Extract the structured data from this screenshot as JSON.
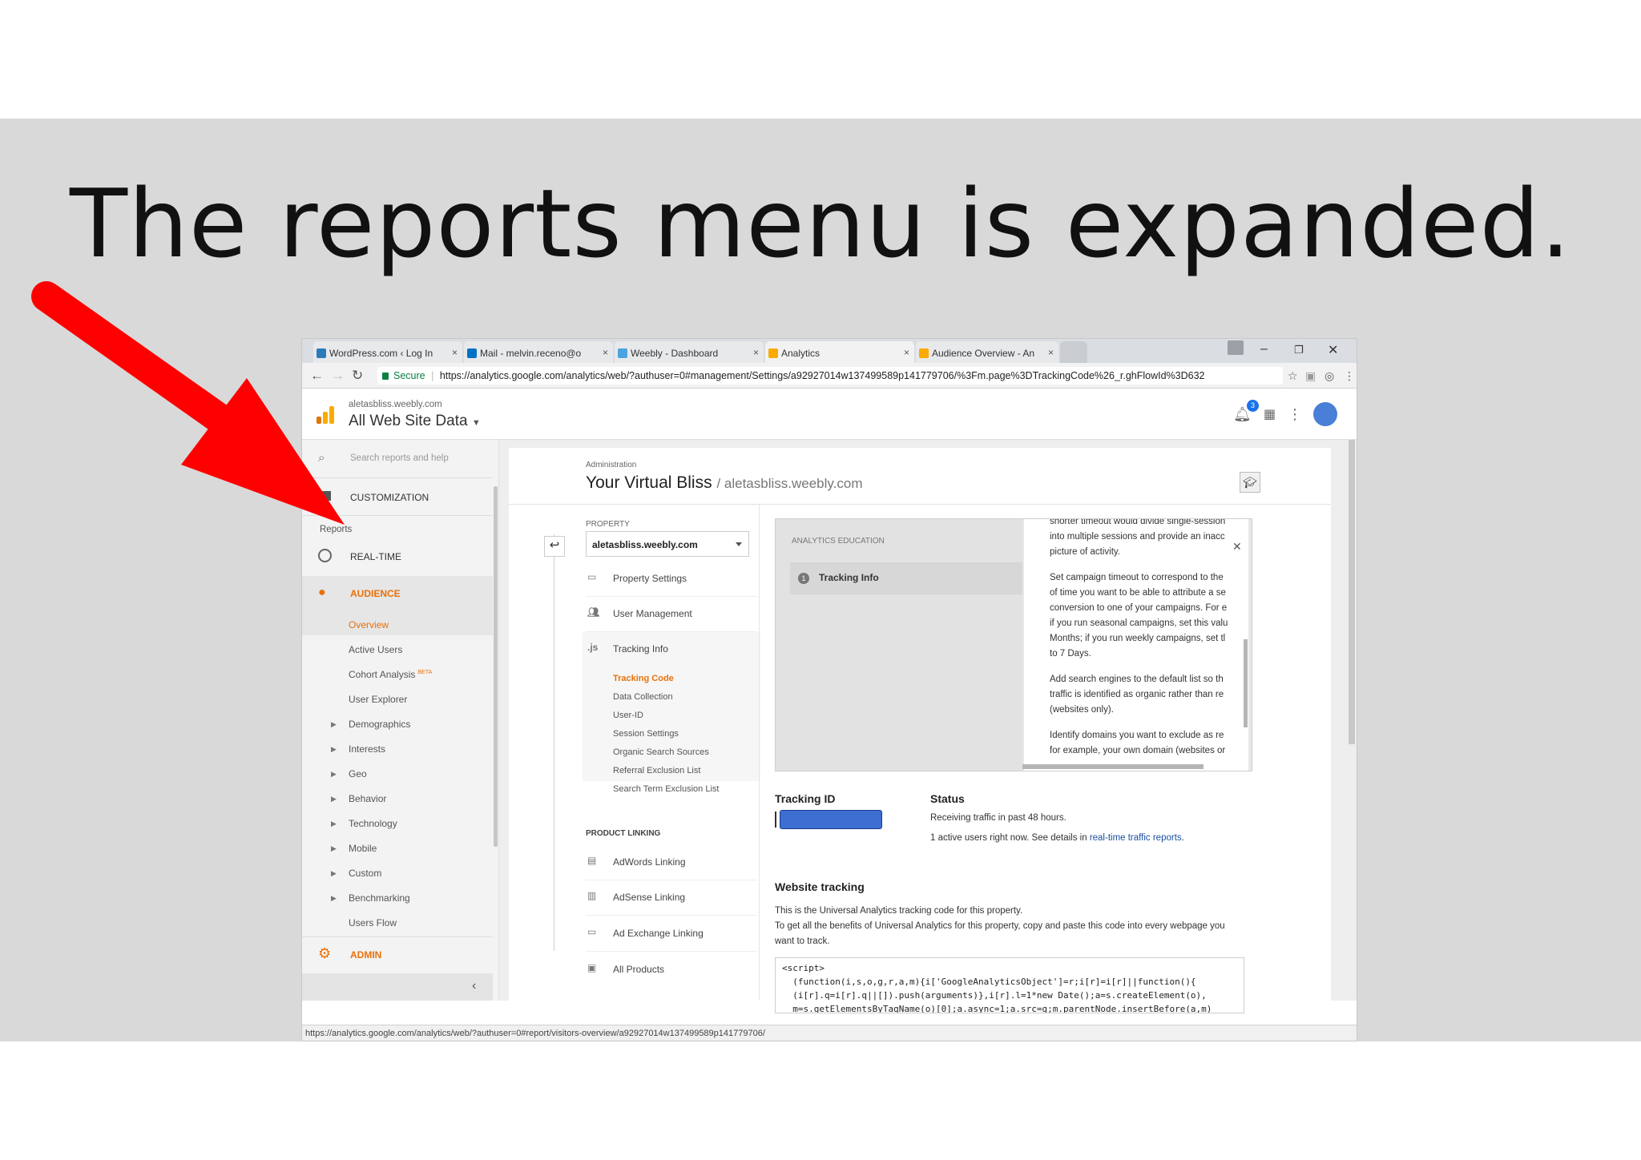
{
  "slide": {
    "caption": "The reports menu is expanded.",
    "arrow_color": "#ff0000"
  },
  "browser": {
    "tabs": [
      {
        "label": "WordPress.com ‹ Log In",
        "icon": "wordpress-icon"
      },
      {
        "label": "Mail - melvin.receno@o",
        "icon": "outlook-icon"
      },
      {
        "label": "Weebly - Dashboard",
        "icon": "weebly-icon"
      },
      {
        "label": "Analytics",
        "icon": "analytics-icon"
      },
      {
        "label": "Audience Overview - An",
        "icon": "analytics-icon"
      }
    ],
    "secure_label": "Secure",
    "url": "https://analytics.google.com/analytics/web/?authuser=0#management/Settings/a92927014w137499589p141779706/%3Fm.page%3DTrackingCode%26_r.ghFlowId%3D632",
    "status_url": "https://analytics.google.com/analytics/web/?authuser=0#report/visitors-overview/a92927014w137499589p141779706/"
  },
  "header": {
    "account": "aletasbliss.weebly.com",
    "view": "All Web Site Data",
    "notification_count": "3"
  },
  "sidebar": {
    "search_placeholder": "Search reports and help",
    "customization": "CUSTOMIZATION",
    "reports_heading": "Reports",
    "realtime": "REAL-TIME",
    "audience": "AUDIENCE",
    "overview": "Overview",
    "active_users": "Active Users",
    "cohort": "Cohort Analysis",
    "beta": "BETA",
    "user_explorer": "User Explorer",
    "expandable": [
      "Demographics",
      "Interests",
      "Geo",
      "Behavior",
      "Technology",
      "Mobile",
      "Custom",
      "Benchmarking"
    ],
    "users_flow": "Users Flow",
    "admin": "ADMIN",
    "accent": "#e8710a"
  },
  "admin": {
    "label": "Administration",
    "title": "Your Virtual Bliss",
    "subtitle": "/ aletasbliss.weebly.com",
    "property_label": "PROPERTY",
    "property_value": "aletasbliss.weebly.com",
    "menu": {
      "property_settings": "Property Settings",
      "user_management": "User Management",
      "tracking_info": "Tracking Info",
      "tracking_sub": [
        "Tracking Code",
        "Data Collection",
        "User-ID",
        "Session Settings",
        "Organic Search Sources",
        "Referral Exclusion List",
        "Search Term Exclusion List"
      ],
      "product_linking": "PRODUCT LINKING",
      "adwords": "AdWords Linking",
      "adsense": "AdSense Linking",
      "adexchange": "Ad Exchange Linking",
      "all_products": "All Products"
    }
  },
  "education": {
    "title": "ANALYTICS EDUCATION",
    "step_number": "1",
    "step_label": "Tracking Info",
    "lines": [
      "shorter timeout would divide single-session",
      "into multiple sessions and provide an inacc",
      "picture of activity.",
      "Set campaign timeout to correspond to the",
      "of time you want to be able to attribute a se",
      "conversion to one of your campaigns. For e",
      "if you run seasonal campaigns, set this valu",
      "Months; if you run weekly campaigns, set tl",
      "to 7 Days.",
      "Add search engines to the default list so th",
      "traffic is identified as organic rather than re",
      "(websites only).",
      "Identify domains you want to exclude as re",
      "for example, your own domain (websites or"
    ]
  },
  "tracking": {
    "id_label": "Tracking ID",
    "status_label": "Status",
    "status_line1": "Receiving traffic in past 48 hours.",
    "status_line2_prefix": "1 active users right now. See details in ",
    "status_link": "real-time traffic reports",
    "status_line2_suffix": ".",
    "website_tracking": "Website tracking",
    "wt_line1": "This is the Universal Analytics tracking code for this property.",
    "wt_line2": "To get all the benefits of Universal Analytics for this property, copy and paste this code into every webpage you",
    "wt_line3": "want to track.",
    "code": "<script>\n  (function(i,s,o,g,r,a,m){i['GoogleAnalyticsObject']=r;i[r]=i[r]||function(){\n  (i[r].q=i[r].q||[]).push(arguments)},i[r].l=1*new Date();a=s.createElement(o),\n  m=s.getElementsByTagName(o)[0];a.async=1;a.src=g;m.parentNode.insertBefore(a,m)"
  }
}
